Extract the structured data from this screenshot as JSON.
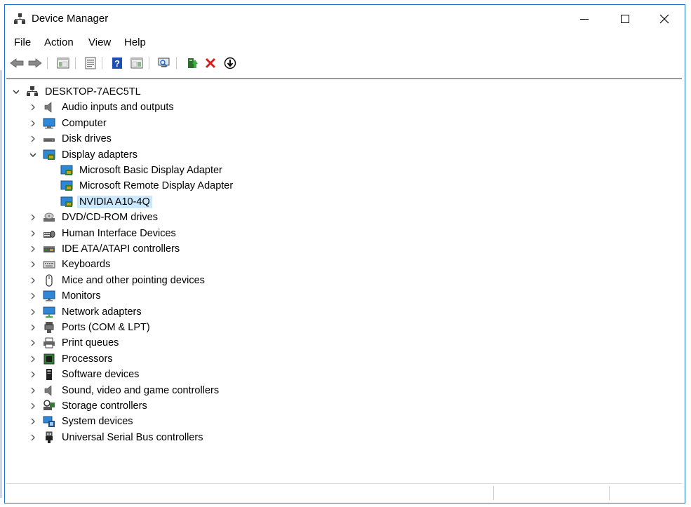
{
  "window": {
    "title": "Device Manager",
    "accent": "#1a73c9"
  },
  "menu": [
    "File",
    "Action",
    "View",
    "Help"
  ],
  "toolbar": [
    "back-icon",
    "forward-icon",
    "show-hide-console-tree-icon",
    "properties-icon",
    "help-icon",
    "view-icon",
    "scan-hardware-changes-icon",
    "update-driver-icon",
    "uninstall-device-icon",
    "disable-device-icon"
  ],
  "tree": {
    "root": "DESKTOP-7AEC5TL",
    "categories": [
      {
        "label": "Audio inputs and outputs",
        "icon": "speaker-icon"
      },
      {
        "label": "Computer",
        "icon": "computer-icon"
      },
      {
        "label": "Disk drives",
        "icon": "disk-drive-icon"
      },
      {
        "label": "Display adapters",
        "icon": "display-adapter-icon",
        "expanded": true,
        "children": [
          "Microsoft Basic Display Adapter",
          "Microsoft Remote Display Adapter",
          "NVIDIA A10-4Q"
        ]
      },
      {
        "label": "DVD/CD-ROM drives",
        "icon": "dvd-drive-icon"
      },
      {
        "label": "Human Interface Devices",
        "icon": "hid-icon"
      },
      {
        "label": "IDE ATA/ATAPI controllers",
        "icon": "ide-controller-icon"
      },
      {
        "label": "Keyboards",
        "icon": "keyboard-icon"
      },
      {
        "label": "Mice and other pointing devices",
        "icon": "mouse-icon"
      },
      {
        "label": "Monitors",
        "icon": "monitor-icon"
      },
      {
        "label": "Network adapters",
        "icon": "network-adapter-icon"
      },
      {
        "label": "Ports (COM & LPT)",
        "icon": "port-icon"
      },
      {
        "label": "Print queues",
        "icon": "printer-icon"
      },
      {
        "label": "Processors",
        "icon": "processor-icon"
      },
      {
        "label": "Software devices",
        "icon": "software-device-icon"
      },
      {
        "label": "Sound, video and game controllers",
        "icon": "sound-controller-icon"
      },
      {
        "label": "Storage controllers",
        "icon": "storage-controller-icon"
      },
      {
        "label": "System devices",
        "icon": "system-device-icon"
      },
      {
        "label": "Universal Serial Bus controllers",
        "icon": "usb-icon"
      }
    ],
    "selected": "NVIDIA A10-4Q",
    "selection_color": "#cce8ff"
  }
}
